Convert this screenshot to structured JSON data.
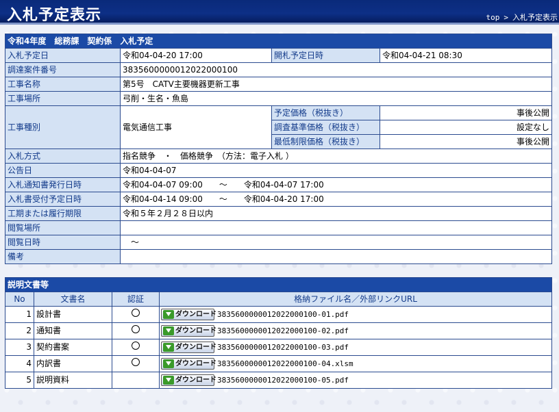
{
  "header": {
    "title": "入札予定表示",
    "breadcrumb": [
      "top",
      "入札予定表示"
    ],
    "breadcrumb_sep": ">"
  },
  "detail": {
    "heading": "令和4年度　総務課　契約係　入札予定",
    "bid_date_label": "入札予定日",
    "bid_date": "令和04-04-20 17:00",
    "open_date_label": "開札予定日時",
    "open_date": "令和04-04-21 08:30",
    "procurement_no_label": "調達案件番号",
    "procurement_no": "383560000001202200010​0",
    "work_name_label": "工事名称",
    "work_name": "第5号　CATV主要機器更新工事",
    "work_place_label": "工事場所",
    "work_place": "弓削・生名・魚島",
    "work_type_label": "工事種別",
    "work_type": "電気通信工事",
    "planned_price_label": "予定価格（税抜き）",
    "planned_price": "事後公開",
    "survey_price_label": "調査基準価格（税抜き）",
    "survey_price": "設定なし",
    "min_price_label": "最低制限価格（税抜き）",
    "min_price": "事後公開",
    "bid_method_label": "入札方式",
    "bid_method": "指名競争　・　価格競争　（方法：電子入札 ）",
    "notice_date_label": "公告日",
    "notice_date": "令和04-04-07",
    "notice_issue_label": "入札通知書発行日時",
    "notice_issue": "令和04-04-07 09:00　　～　　令和04-04-07 17:00",
    "bid_accept_label": "入札書受付予定日時",
    "bid_accept": "令和04-04-14 09:00　　～　　令和04-04-20 17:00",
    "period_label": "工期または履行期限",
    "period": "令和５年２月２８日以内",
    "view_place_label": "閲覧場所",
    "view_place": "",
    "view_date_label": "閲覧日時",
    "view_date": "　～",
    "remarks_label": "備考",
    "remarks": ""
  },
  "docs": {
    "heading": "説明文書等",
    "columns": [
      "No",
      "文書名",
      "認証",
      "格納ファイル名／外部リンクURL"
    ],
    "download_label": "ダウンロード",
    "rows": [
      {
        "no": "1",
        "name": "設計書",
        "auth": "○",
        "file": "383560000001202200010​0-01.pdf"
      },
      {
        "no": "2",
        "name": "通知書",
        "auth": "○",
        "file": "383560000001202200010​0-02.pdf"
      },
      {
        "no": "3",
        "name": "契約書案",
        "auth": "○",
        "file": "383560000001202200010​0-03.pdf"
      },
      {
        "no": "4",
        "name": "内訳書",
        "auth": "○",
        "file": "383560000001202200010​0-04.xlsm"
      },
      {
        "no": "5",
        "name": "説明資料",
        "auth": "",
        "file": "383560000001202200010​0-05.pdf"
      }
    ]
  }
}
